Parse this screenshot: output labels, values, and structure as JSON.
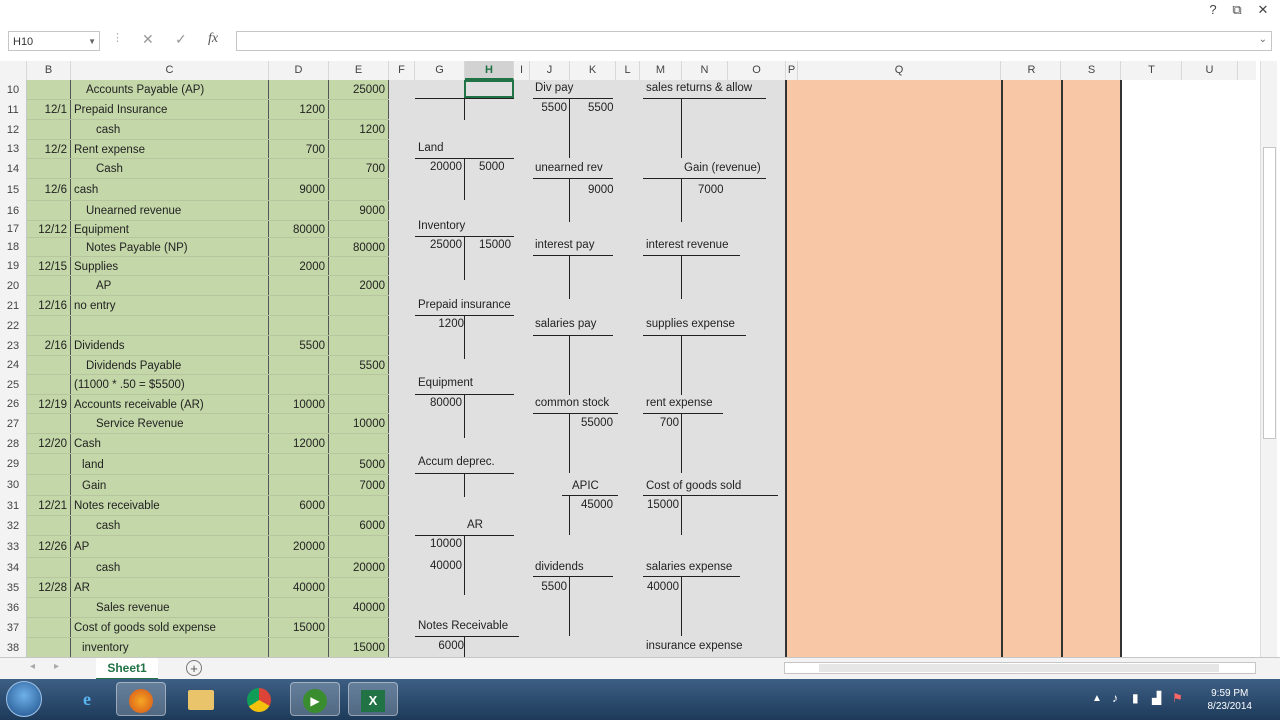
{
  "window": {
    "restore_glyph": "⧉",
    "close_glyph": "✕",
    "help_glyph": "?"
  },
  "formula_bar": {
    "name_box": "H10",
    "formula": "",
    "cancel_icon": "✕",
    "enter_icon": "✓",
    "fx_icon": "fx"
  },
  "columns": [
    "B",
    "C",
    "D",
    "E",
    "F",
    "G",
    "H",
    "I",
    "J",
    "K",
    "L",
    "M",
    "N",
    "O",
    "P",
    "Q",
    "R",
    "S",
    "T",
    "U"
  ],
  "selected_column": "H",
  "rows": [
    "10",
    "11",
    "12",
    "13",
    "14",
    "15",
    "16",
    "17",
    "18",
    "19",
    "20",
    "21",
    "22",
    "23",
    "24",
    "25",
    "26",
    "27",
    "28",
    "29",
    "30",
    "31",
    "32",
    "33",
    "34",
    "35",
    "36",
    "37",
    "38"
  ],
  "journal": [
    {
      "date": "",
      "account": "Accounts Payable (AP)",
      "debit": "",
      "credit": "25000"
    },
    {
      "date": "12/1",
      "account": "Prepaid Insurance",
      "debit": "1200",
      "credit": ""
    },
    {
      "date": "",
      "account": "cash",
      "debit": "",
      "credit": "1200"
    },
    {
      "date": "12/2",
      "account": "Rent expense",
      "debit": "700",
      "credit": ""
    },
    {
      "date": "",
      "account": "Cash",
      "debit": "",
      "credit": "700"
    },
    {
      "date": "12/6",
      "account": "cash",
      "debit": "9000",
      "credit": ""
    },
    {
      "date": "",
      "account": "Unearned revenue",
      "debit": "",
      "credit": "9000"
    },
    {
      "date": "12/12",
      "account": "Equipment",
      "debit": "80000",
      "credit": ""
    },
    {
      "date": "",
      "account": "Notes Payable (NP)",
      "debit": "",
      "credit": "80000"
    },
    {
      "date": "12/15",
      "account": "Supplies",
      "debit": "2000",
      "credit": ""
    },
    {
      "date": "",
      "account": "AP",
      "debit": "",
      "credit": "2000"
    },
    {
      "date": "12/16",
      "account": "no entry",
      "debit": "",
      "credit": ""
    },
    {
      "date": "",
      "account": "",
      "debit": "",
      "credit": ""
    },
    {
      "date": "2/16",
      "account": "Dividends",
      "debit": "5500",
      "credit": ""
    },
    {
      "date": "",
      "account": "Dividends Payable",
      "debit": "",
      "credit": "5500"
    },
    {
      "date": "",
      "account": "(11000 * .50 = $5500)",
      "debit": "",
      "credit": ""
    },
    {
      "date": "12/19",
      "account": "Accounts receivable (AR)",
      "debit": "10000",
      "credit": ""
    },
    {
      "date": "",
      "account": "Service Revenue",
      "debit": "",
      "credit": "10000"
    },
    {
      "date": "12/20",
      "account": "Cash",
      "debit": "12000",
      "credit": ""
    },
    {
      "date": "",
      "account": "land",
      "debit": "",
      "credit": "5000"
    },
    {
      "date": "",
      "account": "Gain",
      "debit": "",
      "credit": "7000"
    },
    {
      "date": "12/21",
      "account": "Notes receivable",
      "debit": "6000",
      "credit": ""
    },
    {
      "date": "",
      "account": "cash",
      "debit": "",
      "credit": "6000"
    },
    {
      "date": "12/26",
      "account": "AP",
      "debit": "20000",
      "credit": ""
    },
    {
      "date": "",
      "account": "cash",
      "debit": "",
      "credit": "20000"
    },
    {
      "date": "12/28",
      "account": "AR",
      "debit": "40000",
      "credit": ""
    },
    {
      "date": "",
      "account": "Sales revenue",
      "debit": "",
      "credit": "40000"
    },
    {
      "date": "",
      "account": "Cost of goods sold expense",
      "debit": "15000",
      "credit": ""
    },
    {
      "date": "",
      "account": "inventory",
      "debit": "",
      "credit": "15000"
    }
  ],
  "taccounts": {
    "land": {
      "title": "Land",
      "debit": "20000",
      "credit": "5000"
    },
    "inventory": {
      "title": "Inventory",
      "debit": "25000",
      "credit": "15000"
    },
    "prepaid": {
      "title": "Prepaid insurance",
      "debit": "1200"
    },
    "equipment": {
      "title": "Equipment",
      "debit": "80000"
    },
    "accum": {
      "title": "Accum deprec."
    },
    "ar": {
      "title": "AR",
      "debit1": "10000",
      "debit2": "40000"
    },
    "notes_rec": {
      "title": "Notes Receivable",
      "debit": "6000"
    },
    "div_pay": {
      "title": "Div pay",
      "debit": "5500",
      "credit": "5500"
    },
    "unearned": {
      "title": "unearned rev",
      "credit": "9000"
    },
    "interest_pay": {
      "title": "interest pay"
    },
    "salaries_pay": {
      "title": "salaries pay"
    },
    "common": {
      "title": "common stock",
      "credit": "55000"
    },
    "apic": {
      "title": "APIC",
      "credit": "45000"
    },
    "dividends": {
      "title": "dividends",
      "debit": "5500"
    },
    "sales_ret": {
      "title": "sales returns & allow"
    },
    "gain": {
      "title": "Gain (revenue)",
      "credit": "7000"
    },
    "int_rev": {
      "title": "interest revenue"
    },
    "supplies_exp": {
      "title": "supplies expense"
    },
    "rent_exp": {
      "title": "rent expense",
      "debit": "700"
    },
    "cogs": {
      "title": "Cost of goods sold",
      "debit": "15000"
    },
    "sal_exp": {
      "title": "salaries expense",
      "debit": "40000"
    },
    "ins_exp": {
      "title": "insurance expense"
    }
  },
  "sheet_tab": "Sheet1",
  "add_sheet": "+",
  "clock": {
    "time": "9:59 PM",
    "date": "8/23/2014"
  },
  "colors": {
    "green": "#c4d7a8",
    "gray": "#e0e0e0",
    "peach": "#f7c7a6",
    "excel_green": "#217346"
  }
}
